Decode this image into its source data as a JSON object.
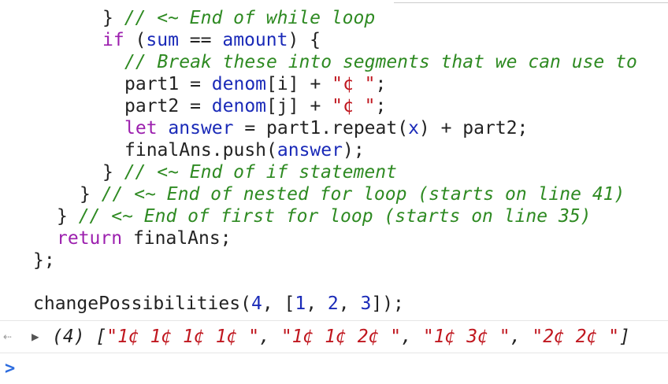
{
  "colors": {
    "keyword": "#9c1fae",
    "variable": "#1a2ab8",
    "comment": "#2e8a22",
    "string": "#c0171f",
    "prompt": "#2d6cdf"
  },
  "code": {
    "l1": {
      "brace": "} ",
      "comment": "// <~ End of while loop"
    },
    "l2": {
      "kw": "if",
      "open": " (",
      "a": "sum",
      "eq": " == ",
      "b": "amount",
      "close": ") {"
    },
    "l3": {
      "comment": "// Break these into segments that we can use to"
    },
    "l4": {
      "lhs": "part1",
      "eq": " = ",
      "arr": "denom",
      "idx": "[i]",
      "plus": " + ",
      "str": "\"¢ \"",
      "semi": ";"
    },
    "l5": {
      "lhs": "part2",
      "eq": " = ",
      "arr": "denom",
      "idx": "[j]",
      "plus": " + ",
      "str": "\"¢ \"",
      "semi": ";"
    },
    "l6": {
      "kw": "let",
      "sp": " ",
      "name": "answer",
      "eq": " = ",
      "call": "part1.repeat(",
      "arg": "x",
      "rest": ") + part2;"
    },
    "l7": {
      "pre": "finalAns.push(",
      "arg": "answer",
      "post": ");"
    },
    "l8": {
      "brace": "} ",
      "comment": "// <~ End of if statement"
    },
    "l9": {
      "brace": "} ",
      "comment": "// <~ End of nested for loop (starts on line 41)"
    },
    "l10": {
      "brace": "} ",
      "comment": "// <~ End of first for loop (starts on line 35)"
    },
    "l11": {
      "kw": "return",
      "rest": " finalAns;"
    },
    "l12": {
      "text": "};"
    },
    "l13": {
      "fn": "changePossibilities(",
      "n1": "4",
      "c1": ", [",
      "n2": "1",
      "c2": ", ",
      "n3": "2",
      "c3": ", ",
      "n4": "3",
      "c4": "]);"
    }
  },
  "console": {
    "result_arrow": "⇠",
    "disclosure": "▶",
    "count": "(4) [",
    "items": [
      "\"1¢ 1¢ 1¢ 1¢ \"",
      "\"1¢ 1¢ 2¢ \"",
      "\"1¢ 3¢ \"",
      "\"2¢ 2¢ \""
    ],
    "separator": ", ",
    "close": "]",
    "prompt": ">"
  }
}
